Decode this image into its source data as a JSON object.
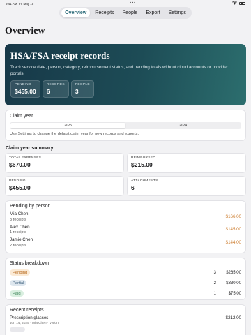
{
  "status_bar": {
    "time": "9:41 AM",
    "date": "Fri May 15",
    "dots": "•••"
  },
  "tabs": [
    {
      "label": "Overview",
      "active": true
    },
    {
      "label": "Receipts",
      "active": false
    },
    {
      "label": "People",
      "active": false
    },
    {
      "label": "Export",
      "active": false
    },
    {
      "label": "Settings",
      "active": false
    }
  ],
  "page_title": "Overview",
  "hero": {
    "title": "HSA/FSA receipt records",
    "description": "Track service date, person, category, reimbursement status, and pending totals without cloud accounts or provider portals.",
    "stats": [
      {
        "label": "PENDING",
        "value": "$455.00"
      },
      {
        "label": "RECORDS",
        "value": "6"
      },
      {
        "label": "PEOPLE",
        "value": "3"
      }
    ]
  },
  "claim_year": {
    "heading": "Claim year",
    "options": [
      "2025",
      "2024"
    ],
    "selected": "2025",
    "note": "Use Settings to change the default claim year for new records and exports."
  },
  "summary": {
    "title": "Claim year summary",
    "cards": [
      {
        "label": "TOTAL EXPENSES",
        "value": "$670.00"
      },
      {
        "label": "REIMBURSED",
        "value": "$215.00"
      },
      {
        "label": "PENDING",
        "value": "$455.00"
      },
      {
        "label": "ATTACHMENTS",
        "value": "6"
      }
    ]
  },
  "pending_by_person": {
    "heading": "Pending by person",
    "people": [
      {
        "name": "Mia Chen",
        "receipts": "3 receipts",
        "amount": "$166.00"
      },
      {
        "name": "Alex Chen",
        "receipts": "1 receipts",
        "amount": "$145.00"
      },
      {
        "name": "Jamie Chen",
        "receipts": "2 receipts",
        "amount": "$144.00"
      }
    ]
  },
  "status_breakdown": {
    "heading": "Status breakdown",
    "rows": [
      {
        "status": "Pending",
        "count": "3",
        "amount": "$265.00"
      },
      {
        "status": "Partial",
        "count": "2",
        "amount": "$330.00"
      },
      {
        "status": "Paid",
        "count": "1",
        "amount": "$75.00"
      }
    ]
  },
  "recent_receipts": {
    "heading": "Recent receipts",
    "items": [
      {
        "title": "Prescription glasses",
        "meta": "Jun 14, 2025 · Mia Chen · Vision",
        "amount": "$212.00"
      }
    ]
  },
  "colors": {
    "accent": "#2a6a78",
    "hero_start": "#173848",
    "hero_end": "#2c6e6e",
    "pending_amount": "#cc7a2a"
  }
}
